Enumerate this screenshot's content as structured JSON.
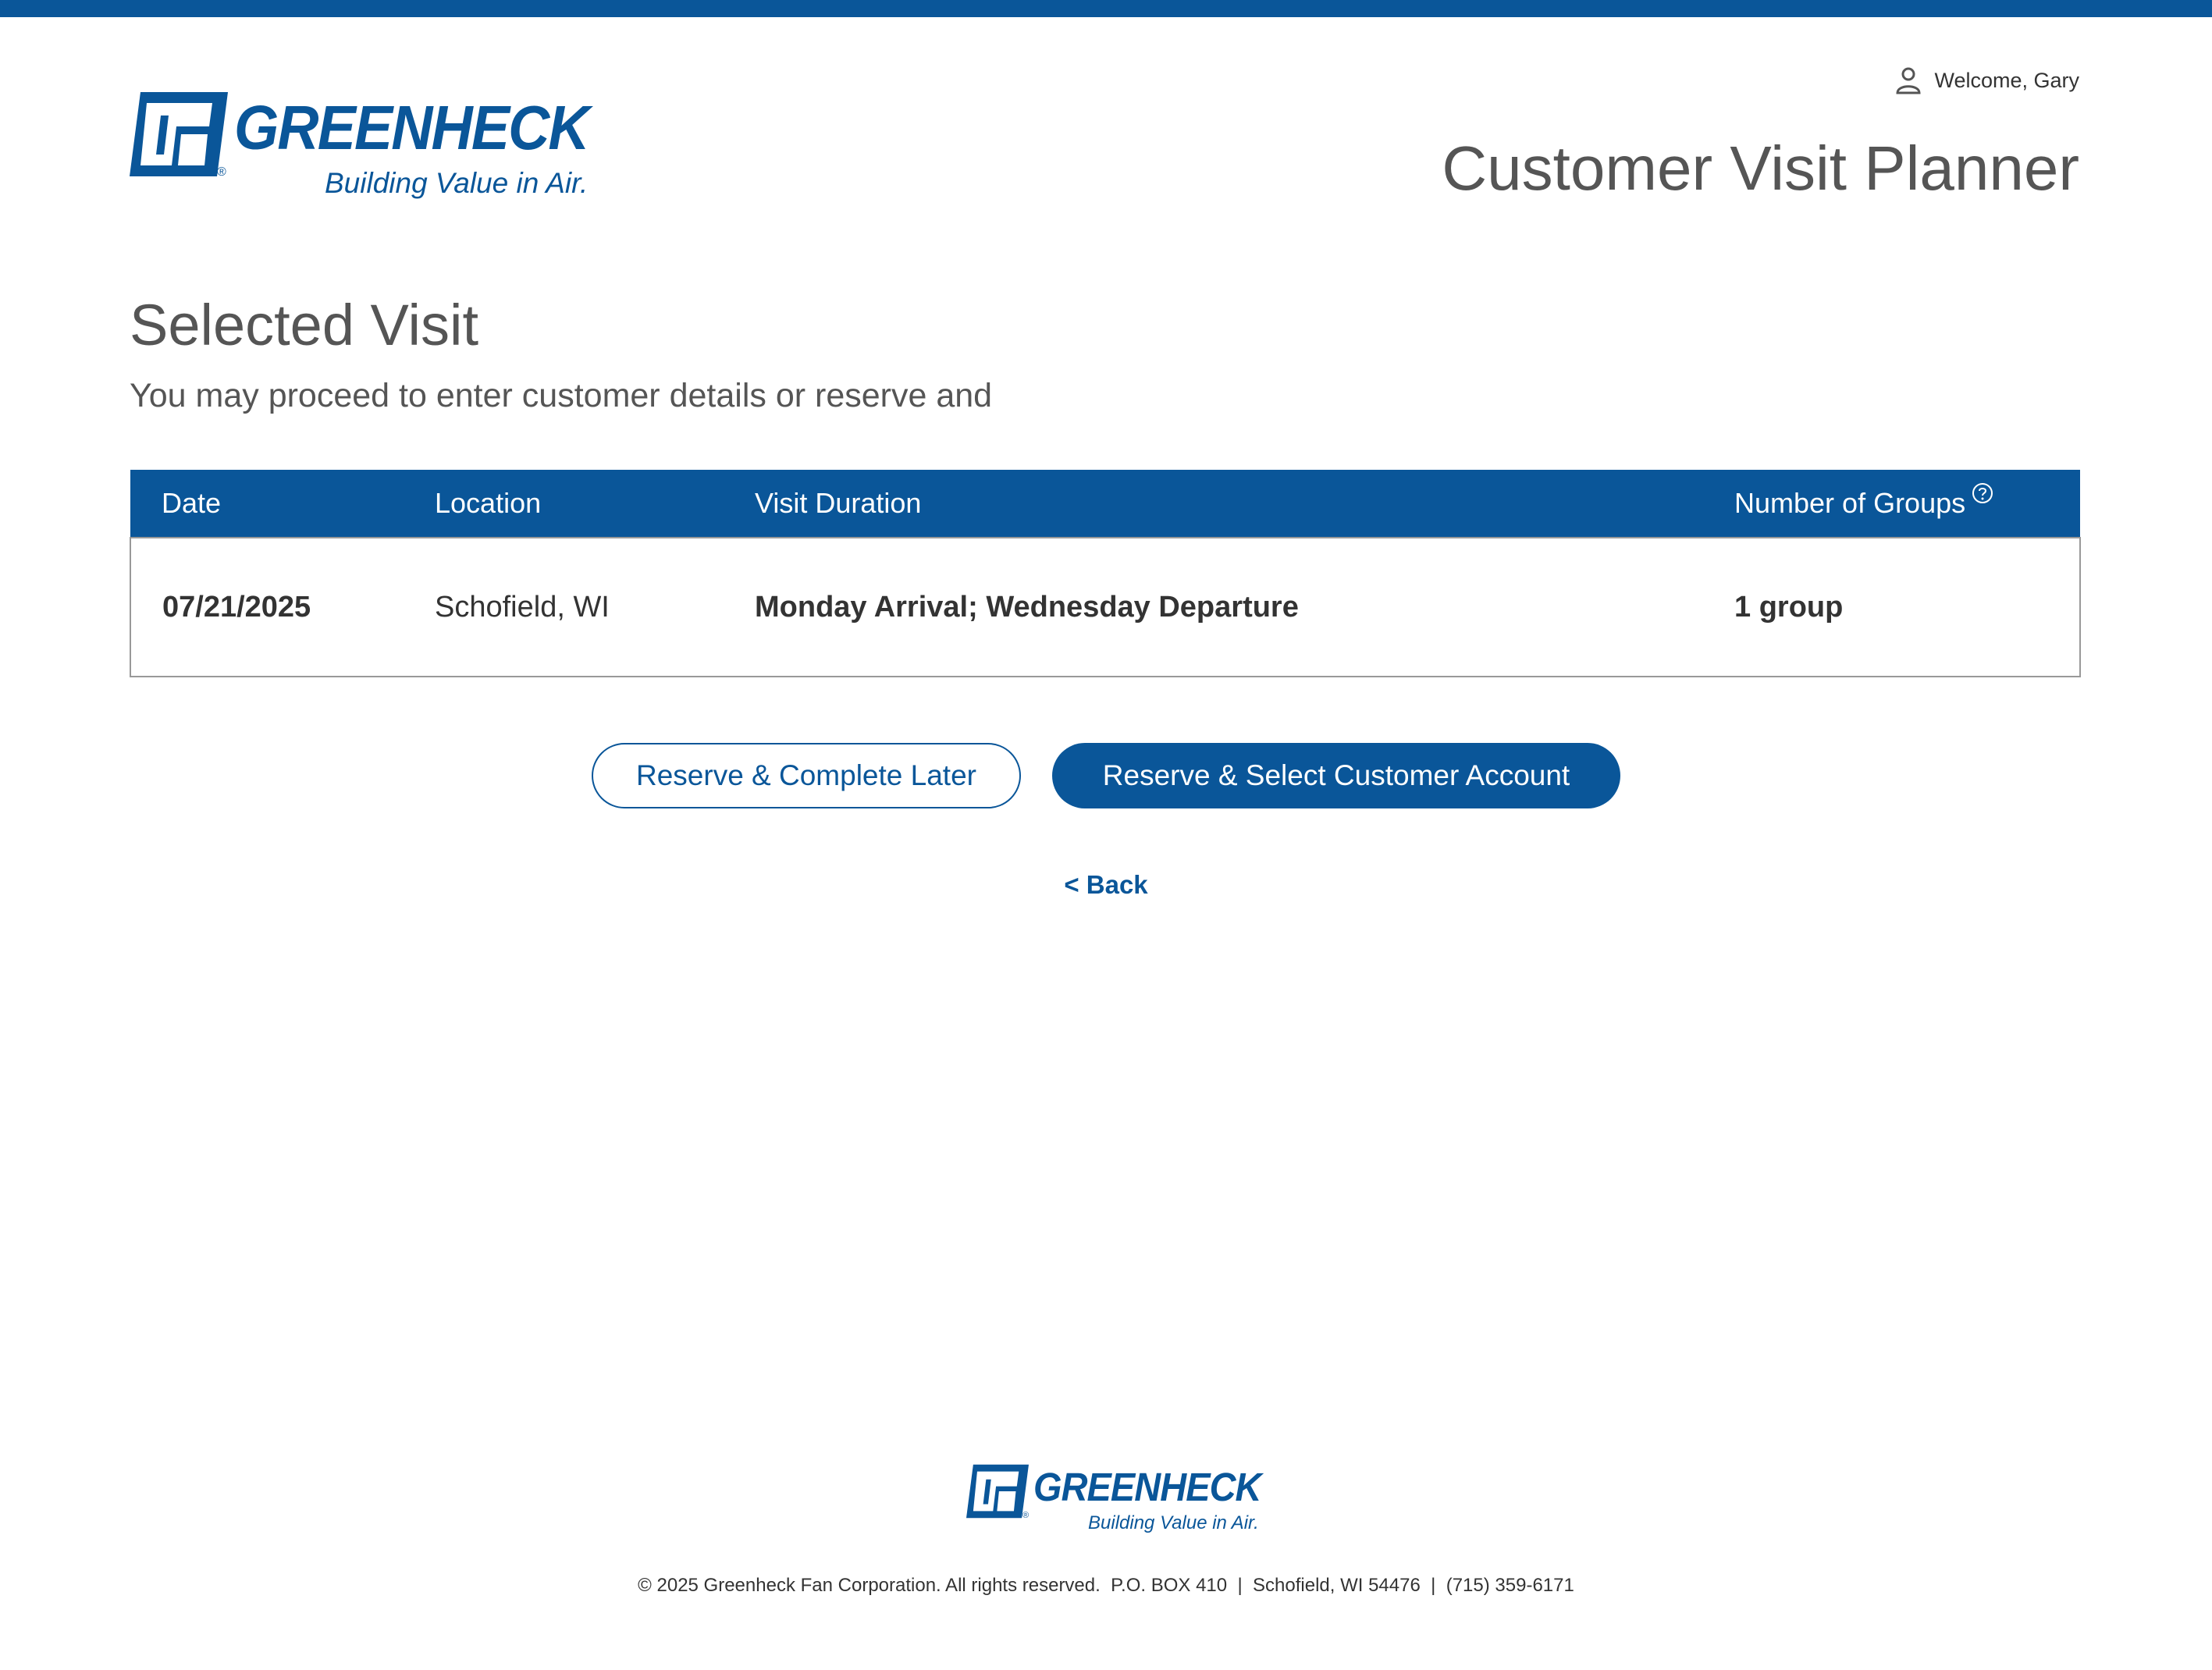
{
  "header": {
    "logo_text": "GREENHECK",
    "logo_tagline": "Building Value in Air.",
    "welcome_text": "Welcome, Gary",
    "app_title": "Customer Visit Planner"
  },
  "main": {
    "title": "Selected Visit",
    "subtitle": "You may proceed to enter customer details or reserve and",
    "table": {
      "columns": [
        "Date",
        "Location",
        "Visit Duration",
        "Number of Groups"
      ],
      "row": {
        "date": "07/21/2025",
        "location": "Schofield, WI",
        "duration": "Monday Arrival; Wednesday Departure",
        "groups": "1 group"
      }
    },
    "buttons": {
      "reserve_later": "Reserve & Complete Later",
      "reserve_select": "Reserve & Select Customer Account"
    },
    "back_link": "< Back"
  },
  "footer": {
    "logo_text": "GREENHECK",
    "logo_tagline": "Building Value in Air.",
    "copyright": "© 2025 Greenheck Fan Corporation. All rights reserved.  P.O. BOX 410  |  Schofield, WI 54476  |  (715) 359-6171"
  },
  "colors": {
    "brand_blue": "#0a5699",
    "text_gray": "#555555"
  },
  "icons": [
    "user-icon",
    "help-circle-icon",
    "greenheck-logo-icon"
  ]
}
